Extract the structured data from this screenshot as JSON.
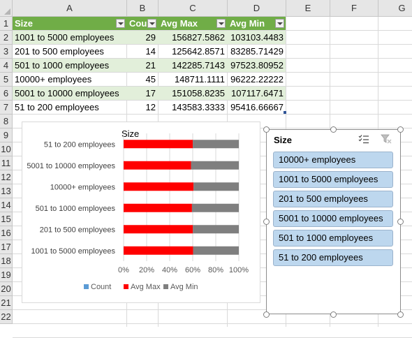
{
  "columns": [
    "A",
    "B",
    "C",
    "D",
    "E",
    "F",
    "G"
  ],
  "rows": [
    "1",
    "2",
    "3",
    "4",
    "5",
    "6",
    "7",
    "8",
    "9",
    "10",
    "11",
    "12",
    "13",
    "14",
    "15",
    "16",
    "17",
    "18",
    "19",
    "20",
    "21",
    "22"
  ],
  "table": {
    "headers": [
      "Size",
      "Count",
      "Avg Max",
      "Avg Min"
    ],
    "rows": [
      [
        "1001 to 5000 employees",
        "29",
        "156827.5862",
        "103103.4483"
      ],
      [
        "201 to 500 employees",
        "14",
        "125642.8571",
        "83285.71429"
      ],
      [
        "501 to 1000 employees",
        "21",
        "142285.7143",
        "97523.80952"
      ],
      [
        "10000+ employees",
        "45",
        "148711.1111",
        "96222.22222"
      ],
      [
        "5001 to 10000 employees",
        "17",
        "151058.8235",
        "107117.6471"
      ],
      [
        "51 to 200 employees",
        "12",
        "143583.3333",
        "95416.66667"
      ]
    ]
  },
  "chart_data": {
    "type": "bar",
    "orientation": "horizontal",
    "stacking": "percent",
    "title": "Size",
    "categories": [
      "51 to 200 employees",
      "5001 to 10000 employees",
      "10000+ employees",
      "501 to 1000 employees",
      "201 to 500 employees",
      "1001 to 5000 employees"
    ],
    "series": [
      {
        "name": "Count",
        "color": "#5b9bd5",
        "values": [
          12,
          17,
          45,
          21,
          14,
          29
        ]
      },
      {
        "name": "Avg Max",
        "color": "#ff0000",
        "values": [
          143583.3333,
          151058.8235,
          148711.1111,
          142285.7143,
          125642.8571,
          156827.5862
        ]
      },
      {
        "name": "Avg Min",
        "color": "#7f7f7f",
        "values": [
          95416.66667,
          107117.6471,
          96222.22222,
          97523.80952,
          83285.71429,
          103103.4483
        ]
      }
    ],
    "x_ticks": [
      "0%",
      "20%",
      "40%",
      "60%",
      "80%",
      "100%"
    ],
    "xlim": [
      0,
      1
    ],
    "legend_position": "bottom",
    "grid": true
  },
  "slicer": {
    "title": "Size",
    "items": [
      "10000+ employees",
      "1001 to 5000 employees",
      "201 to 500 employees",
      "5001 to 10000 employees",
      "501 to 1000 employees",
      "51 to 200 employees"
    ],
    "icons": [
      "multi-select-icon",
      "clear-filter-icon"
    ]
  },
  "colors": {
    "table_header": "#70ad47",
    "table_band": "#e2efda",
    "slicer_item": "#bdd7ee"
  }
}
